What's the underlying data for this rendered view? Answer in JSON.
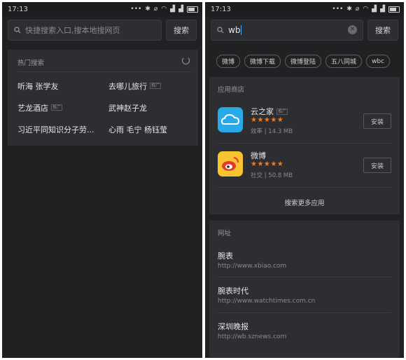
{
  "left": {
    "status": {
      "time": "17:13"
    },
    "search": {
      "placeholder": "快捷搜索入口,搜本地搜网页",
      "button": "搜索"
    },
    "hot": {
      "title": "热门搜索",
      "items": [
        {
          "text": "听海 张学友",
          "tag": ""
        },
        {
          "text": "去哪儿旅行",
          "tag": "推广"
        },
        {
          "text": "艺龙酒店",
          "tag": "推广"
        },
        {
          "text": "武神赵子龙",
          "tag": ""
        },
        {
          "text": "习近平同知识分子劳...",
          "tag": ""
        },
        {
          "text": "心雨 毛宁 杨钰莹",
          "tag": ""
        }
      ]
    }
  },
  "right": {
    "status": {
      "time": "17:13"
    },
    "search": {
      "value": "wb",
      "button": "搜索"
    },
    "suggestions": [
      "微博",
      "微博下载",
      "微博登陆",
      "五八同城",
      "wbc"
    ],
    "appstore": {
      "title": "应用商店",
      "apps": [
        {
          "name": "云之家",
          "tag": "推广",
          "stars": "★★★★★",
          "category": "效率",
          "size": "14.3 MB",
          "install": "安装",
          "icon_color": "#29a9e8"
        },
        {
          "name": "微博",
          "tag": "",
          "stars": "★★★★★",
          "category": "社交",
          "size": "50.8 MB",
          "install": "安装",
          "icon_color": "#f7c32e"
        }
      ],
      "more": "搜索更多应用"
    },
    "sites": {
      "title": "网址",
      "items": [
        {
          "name": "腕表",
          "url": "http://www.xbiao.com"
        },
        {
          "name": "腕表时代",
          "url": "http://www.watchtimes.com.cn"
        },
        {
          "name": "深圳晚报",
          "url": "http://wb.sznews.com"
        }
      ]
    }
  }
}
